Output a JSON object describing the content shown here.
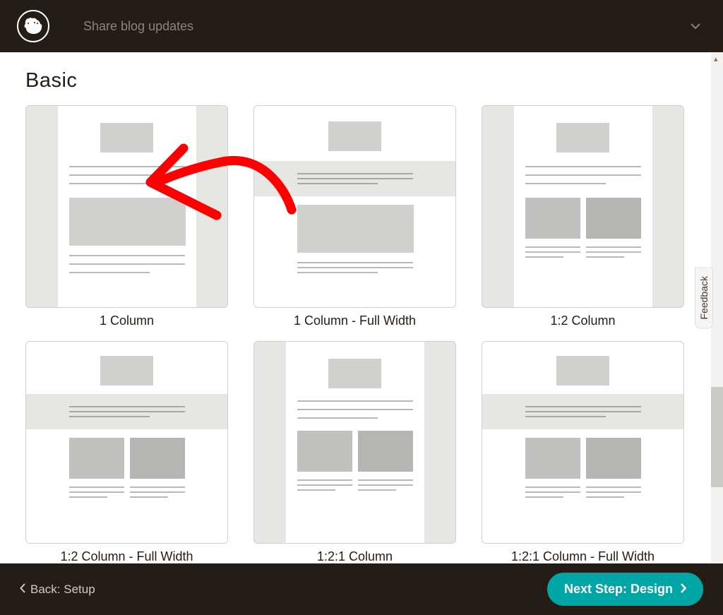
{
  "header": {
    "title": "Share blog updates"
  },
  "section": {
    "title": "Basic"
  },
  "templates": [
    {
      "label": "1 Column"
    },
    {
      "label": "1 Column - Full Width"
    },
    {
      "label": "1:2 Column"
    },
    {
      "label": "1:2 Column - Full Width"
    },
    {
      "label": "1:2:1 Column"
    },
    {
      "label": "1:2:1 Column - Full Width"
    }
  ],
  "footer": {
    "back_label": "Back: Setup",
    "next_label": "Next Step: Design"
  },
  "feedback": {
    "label": "Feedback"
  }
}
